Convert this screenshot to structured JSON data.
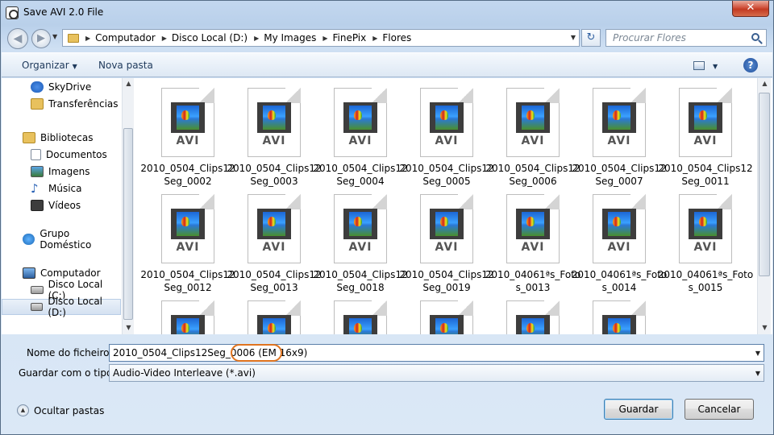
{
  "window": {
    "title": "Save AVI 2.0 File",
    "close_label": "✕"
  },
  "address": {
    "crumbs": [
      "Computador",
      "Disco Local (D:)",
      "My Images",
      "FinePix",
      "Flores"
    ],
    "search_placeholder": "Procurar Flores"
  },
  "toolbar": {
    "organize_label": "Organizar",
    "new_folder_label": "Nova pasta",
    "help_label": "?"
  },
  "sidebar": {
    "items": [
      {
        "label": "SkyDrive",
        "icon": "cloud-icon"
      },
      {
        "label": "Transferências",
        "icon": "downloads-folder-icon"
      },
      {
        "label": "Bibliotecas",
        "icon": "libraries-icon"
      },
      {
        "label": "Documentos",
        "icon": "documents-icon"
      },
      {
        "label": "Imagens",
        "icon": "pictures-icon"
      },
      {
        "label": "Música",
        "icon": "music-icon"
      },
      {
        "label": "Vídeos",
        "icon": "videos-icon"
      },
      {
        "label": "Grupo Doméstico",
        "icon": "homegroup-icon"
      },
      {
        "label": "Computador",
        "icon": "computer-icon"
      },
      {
        "label": "Disco Local (C:)",
        "icon": "drive-c-icon"
      },
      {
        "label": "Disco Local (D:)",
        "icon": "drive-d-icon",
        "selected": true
      }
    ]
  },
  "files": {
    "type_badge": "AVI",
    "items": [
      "2010_0504_Clips12Seg_0002",
      "2010_0504_Clips12Seg_0003",
      "2010_0504_Clips12Seg_0004",
      "2010_0504_Clips12Seg_0005",
      "2010_0504_Clips12Seg_0006",
      "2010_0504_Clips12Seg_0007",
      "2010_0504_Clips12Seg_0011",
      "2010_0504_Clips12Seg_0012",
      "2010_0504_Clips12Seg_0013",
      "2010_0504_Clips12Seg_0018",
      "2010_0504_Clips12Seg_0019",
      "2010_04061ªs_Fotos_0013",
      "2010_04061ªs_Fotos_0014",
      "2010_04061ªs_Fotos_0015"
    ],
    "partial_row_count": 6
  },
  "form": {
    "filename_label": "Nome do ficheiro:",
    "filename_value": "2010_0504_Clips12Seg_0006 (EM 16x9)",
    "type_label": "Guardar com o tipo:",
    "type_value": "Audio-Video Interleave (*.avi)"
  },
  "footer": {
    "hide_folders_label": "Ocultar pastas",
    "save_label": "Guardar",
    "cancel_label": "Cancelar"
  },
  "colors": {
    "highlight_ring": "#e0741f",
    "selected_item": "#d4e1f1"
  }
}
